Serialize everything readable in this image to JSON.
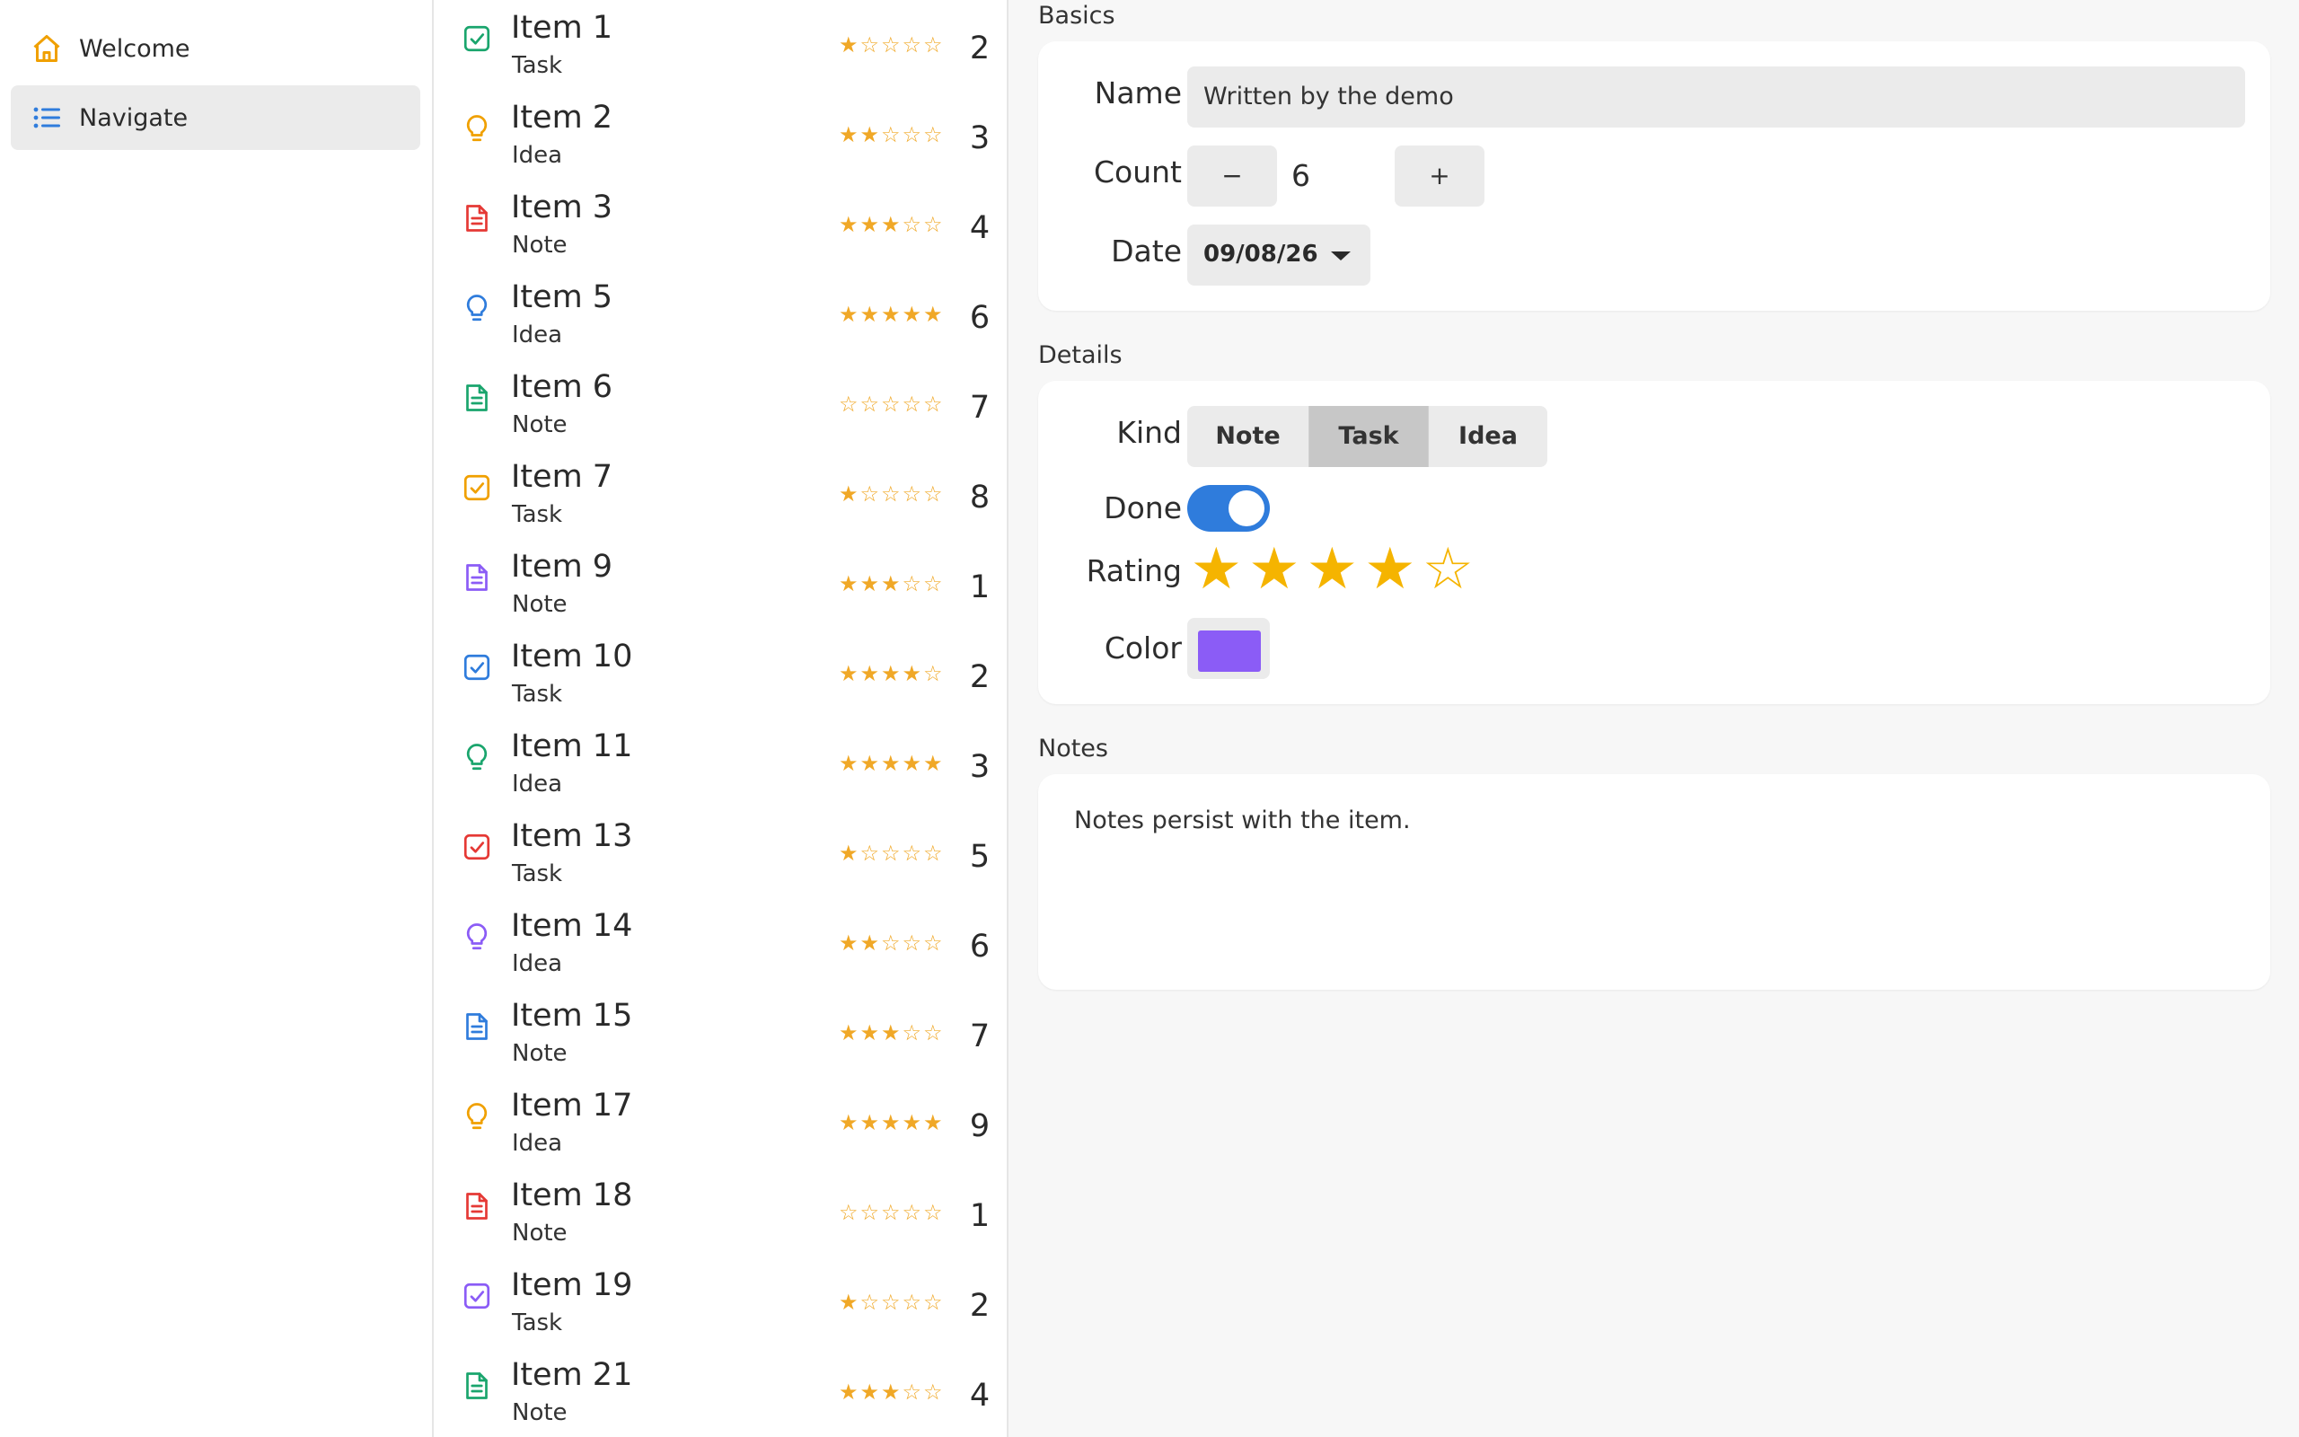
{
  "sidebar": {
    "items": [
      {
        "label": "Welcome",
        "icon": "home-icon",
        "color": "#f0a000",
        "selected": false
      },
      {
        "label": "Navigate",
        "icon": "list-icon",
        "color": "#2f7cdc",
        "selected": true
      }
    ]
  },
  "list": {
    "items": [
      {
        "title": "Item 1",
        "kind": "Task",
        "icon_color": "#1aa56d",
        "rating": 1,
        "count": "2"
      },
      {
        "title": "Item 2",
        "kind": "Idea",
        "icon_color": "#f0a000",
        "rating": 2,
        "count": "3"
      },
      {
        "title": "Item 3",
        "kind": "Note",
        "icon_color": "#e53935",
        "rating": 3,
        "count": "4"
      },
      {
        "title": "Item 5",
        "kind": "Idea",
        "icon_color": "#2f7cdc",
        "rating": 5,
        "count": "6"
      },
      {
        "title": "Item 6",
        "kind": "Note",
        "icon_color": "#1aa56d",
        "rating": 0,
        "count": "7"
      },
      {
        "title": "Item 7",
        "kind": "Task",
        "icon_color": "#f0a000",
        "rating": 1,
        "count": "8"
      },
      {
        "title": "Item 9",
        "kind": "Note",
        "icon_color": "#8b5cf6",
        "rating": 3,
        "count": "1"
      },
      {
        "title": "Item 10",
        "kind": "Task",
        "icon_color": "#2f7cdc",
        "rating": 4,
        "count": "2"
      },
      {
        "title": "Item 11",
        "kind": "Idea",
        "icon_color": "#1aa56d",
        "rating": 5,
        "count": "3"
      },
      {
        "title": "Item 13",
        "kind": "Task",
        "icon_color": "#e53935",
        "rating": 1,
        "count": "5"
      },
      {
        "title": "Item 14",
        "kind": "Idea",
        "icon_color": "#8b5cf6",
        "rating": 2,
        "count": "6"
      },
      {
        "title": "Item 15",
        "kind": "Note",
        "icon_color": "#2f7cdc",
        "rating": 3,
        "count": "7"
      },
      {
        "title": "Item 17",
        "kind": "Idea",
        "icon_color": "#f0a000",
        "rating": 5,
        "count": "9"
      },
      {
        "title": "Item 18",
        "kind": "Note",
        "icon_color": "#e53935",
        "rating": 0,
        "count": "1"
      },
      {
        "title": "Item 19",
        "kind": "Task",
        "icon_color": "#8b5cf6",
        "rating": 1,
        "count": "2"
      },
      {
        "title": "Item 21",
        "kind": "Note",
        "icon_color": "#1aa56d",
        "rating": 3,
        "count": "4"
      }
    ]
  },
  "detail": {
    "basics": {
      "section_label": "Basics",
      "name_label": "Name",
      "name_value": "Written by the demo",
      "count_label": "Count",
      "count_minus": "−",
      "count_value": "6",
      "count_plus": "+",
      "date_label": "Date",
      "date_value": "09/08/26"
    },
    "details": {
      "section_label": "Details",
      "kind_label": "Kind",
      "kind_options": [
        "Note",
        "Task",
        "Idea"
      ],
      "kind_selected": "Task",
      "done_label": "Done",
      "done_value": true,
      "rating_label": "Rating",
      "rating_value": 4,
      "rating_max": 5,
      "color_label": "Color",
      "color_value": "#8b5cf6"
    },
    "notes": {
      "section_label": "Notes",
      "text": "Notes persist with the item."
    }
  }
}
